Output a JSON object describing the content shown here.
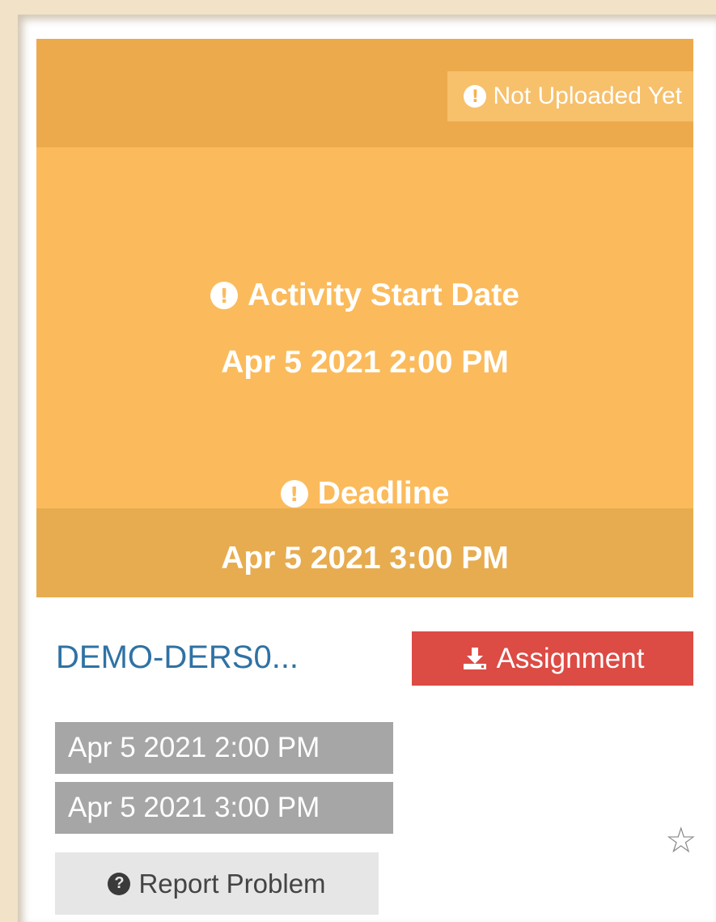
{
  "card": {
    "upload_status": "Not Uploaded Yet",
    "start_label": "Activity Start Date",
    "start_value": "Apr 5 2021 2:00 PM",
    "deadline_label": "Deadline",
    "deadline_value": "Apr 5 2021 3:00 PM",
    "colors": {
      "card_bg": "#fbbb5c",
      "card_band": "#ecaa4c",
      "assignment_button": "#dc4b44",
      "title_link": "#2f72a4"
    }
  },
  "activity": {
    "title": "DEMO-DERS0...",
    "assignment_label": "Assignment",
    "assignment_icon": "download-icon",
    "start_chip": "Apr 5 2021 2:00 PM",
    "end_chip": "Apr 5 2021 3:00 PM",
    "favorite_icon": "star-outline-icon",
    "report_label": "Report Problem",
    "report_icon": "question-circle-icon"
  }
}
